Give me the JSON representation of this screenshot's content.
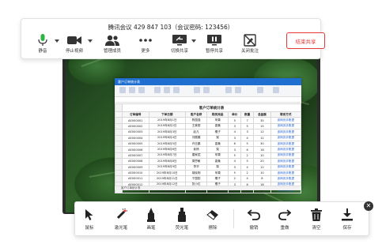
{
  "meeting": {
    "title": "腾讯会议 429 847 103（会议密码: 123456）"
  },
  "toolbar": {
    "mute_label": "静音",
    "stop_video_label": "停止视频",
    "manage_members_label": "管理成员",
    "more_label": "更多",
    "switch_share_label": "切换共享",
    "pause_share_label": "暂停共享",
    "close_annotation_label": "关闭批注",
    "end_share_label": "结束共享",
    "end_share_color": "#e53935"
  },
  "sheet": {
    "title_bar_color": "#1f6fd0",
    "caption": "客户订单统计表",
    "headers": [
      "订单编号",
      "下单日期",
      "客户名称",
      "购买商品",
      "单价",
      "数量",
      "总金额",
      "联系方式"
    ],
    "rows": [
      [
        "AE000001",
        "2019年8月1日",
        "陈国强",
        "苹果",
        "5",
        "7",
        "35",
        "该网页手账提"
      ],
      [
        "AE000002",
        "2019年8月2日",
        "王美丽",
        "香蕉",
        "3",
        "5",
        "15",
        "该网页手账提"
      ],
      [
        "AE000003",
        "2019年8月3日",
        "赵凡",
        "橘子",
        "4",
        "3",
        "12",
        "该网页手账提"
      ],
      [
        "AE000004",
        "2019年8月4日",
        "刘展模",
        "梨",
        "3",
        "4",
        "12",
        "该网页手账提"
      ],
      [
        "AE000005",
        "2019年8月5日",
        "许志鹏",
        "香蕉",
        "6",
        "5",
        "30",
        "该网页手账提"
      ],
      [
        "AE000006",
        "2019年8月6日",
        "俞杨",
        "梨",
        "3",
        "6",
        "18",
        "该网页手账提"
      ],
      [
        "AE000007",
        "2019年8月7日",
        "唐家斌",
        "苹果",
        "5",
        "2",
        "10",
        "该网页手账提"
      ],
      [
        "AE000008",
        "2019年8月8日",
        "周思敏",
        "香蕉",
        "4",
        "5",
        "20",
        "该网页手账提"
      ],
      [
        "AE000009",
        "2019年8月9日",
        "李华",
        "梨",
        "3",
        "4",
        "12",
        "该网页手账提"
      ],
      [
        "AE000010",
        "2019年8月10日",
        "胡晓明",
        "苹果",
        "5",
        "2",
        "10",
        "该网页手账提"
      ],
      [
        "AE000011",
        "2019年8月11日",
        "于国阳",
        "橘子",
        "2",
        "4",
        "8",
        "该网页手账提"
      ],
      [
        "AE000012",
        "2019年8月12日",
        "张小红",
        "橘子",
        "3",
        "6",
        "18",
        "该网页手账提"
      ],
      [
        "AE000013",
        "2019年8月13日",
        "赵雪英",
        "苹果",
        "4",
        "5",
        "20",
        "该网页手账提"
      ]
    ],
    "status_tab": "客户订单统计表"
  },
  "annotation": {
    "pointer_label": "鼠标",
    "laser_label": "激光笔",
    "pen_label": "画笔",
    "highlighter_label": "荧光笔",
    "eraser_label": "擦除",
    "undo_label": "撤销",
    "redo_label": "重做",
    "clear_label": "清空",
    "save_label": "保存",
    "close_glyph": "✕"
  }
}
